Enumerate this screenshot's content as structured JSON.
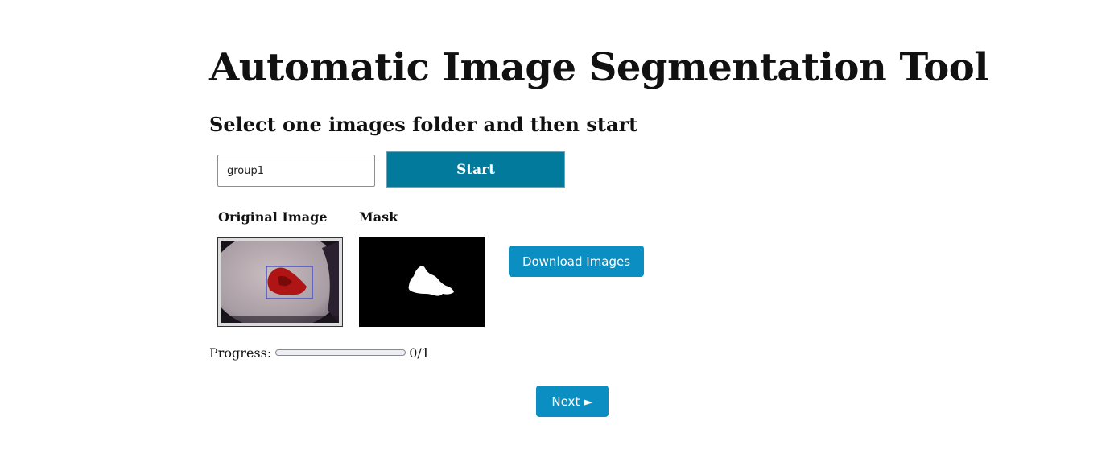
{
  "header": {
    "title": "Automatic Image Segmentation Tool",
    "subtitle": "Select one images folder and then start"
  },
  "controls": {
    "folder_value": "group1",
    "start_label": "Start"
  },
  "images": {
    "original_label": "Original Image",
    "mask_label": "Mask",
    "download_label": "Download Images"
  },
  "progress": {
    "label": "Progress:",
    "value": 0,
    "total": 1,
    "text": "0/1"
  },
  "navigation": {
    "next_label": "Next ►"
  },
  "colors": {
    "start_button": "#017a9c",
    "action_button": "#0b8fc2",
    "bounding_box": "#2b3bd6",
    "lesion": "#b01515"
  }
}
